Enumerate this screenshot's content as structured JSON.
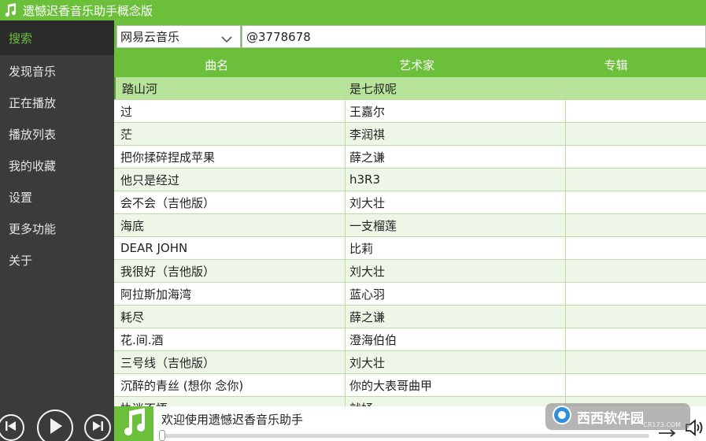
{
  "window": {
    "title": "遗憾迟香音乐助手概念版"
  },
  "sidebar": {
    "items": [
      {
        "label": "搜索"
      },
      {
        "label": "发现音乐"
      },
      {
        "label": "正在播放"
      },
      {
        "label": "播放列表"
      },
      {
        "label": "我的收藏"
      },
      {
        "label": "设置"
      },
      {
        "label": "更多功能"
      },
      {
        "label": "关于"
      }
    ]
  },
  "search": {
    "source": "网易云音乐",
    "query": "@3778678"
  },
  "table": {
    "headers": [
      "曲名",
      "艺术家",
      "专辑"
    ],
    "rows": [
      {
        "title": "踏山河",
        "artist": "是七叔呢",
        "album": ""
      },
      {
        "title": "过",
        "artist": "王嘉尔",
        "album": ""
      },
      {
        "title": "茫",
        "artist": "李润祺",
        "album": ""
      },
      {
        "title": "把你揉碎捏成苹果",
        "artist": "薛之谦",
        "album": ""
      },
      {
        "title": "他只是经过",
        "artist": "h3R3",
        "album": ""
      },
      {
        "title": "会不会（吉他版）",
        "artist": "刘大壮",
        "album": ""
      },
      {
        "title": "海底",
        "artist": "一支榴莲",
        "album": ""
      },
      {
        "title": "DEAR JOHN",
        "artist": "比莉",
        "album": ""
      },
      {
        "title": "我很好（吉他版）",
        "artist": "刘大壮",
        "album": ""
      },
      {
        "title": "阿拉斯加海湾",
        "artist": "蓝心羽",
        "album": ""
      },
      {
        "title": "耗尽",
        "artist": "薛之谦",
        "album": ""
      },
      {
        "title": "花.间.酒",
        "artist": "澄海伯伯",
        "album": ""
      },
      {
        "title": "三号线（吉他版）",
        "artist": "刘大壮",
        "album": ""
      },
      {
        "title": "沉醉的青丝 (想你 念你)",
        "artist": "你的大表哥曲甲",
        "album": ""
      },
      {
        "title": "执迷不悟",
        "artist": "就妤 ",
        "album": ""
      }
    ]
  },
  "player": {
    "now_playing": "欢迎使用遗憾迟香音乐助手",
    "progress": 0.0
  },
  "watermark": {
    "text": "西西软件园",
    "sub": "CR173.COM"
  },
  "colors": {
    "accent": "#6cbf3a",
    "sidebar": "#3b3b3b",
    "row_alt": "#eef7e7",
    "row_selected": "#b8e39a"
  }
}
